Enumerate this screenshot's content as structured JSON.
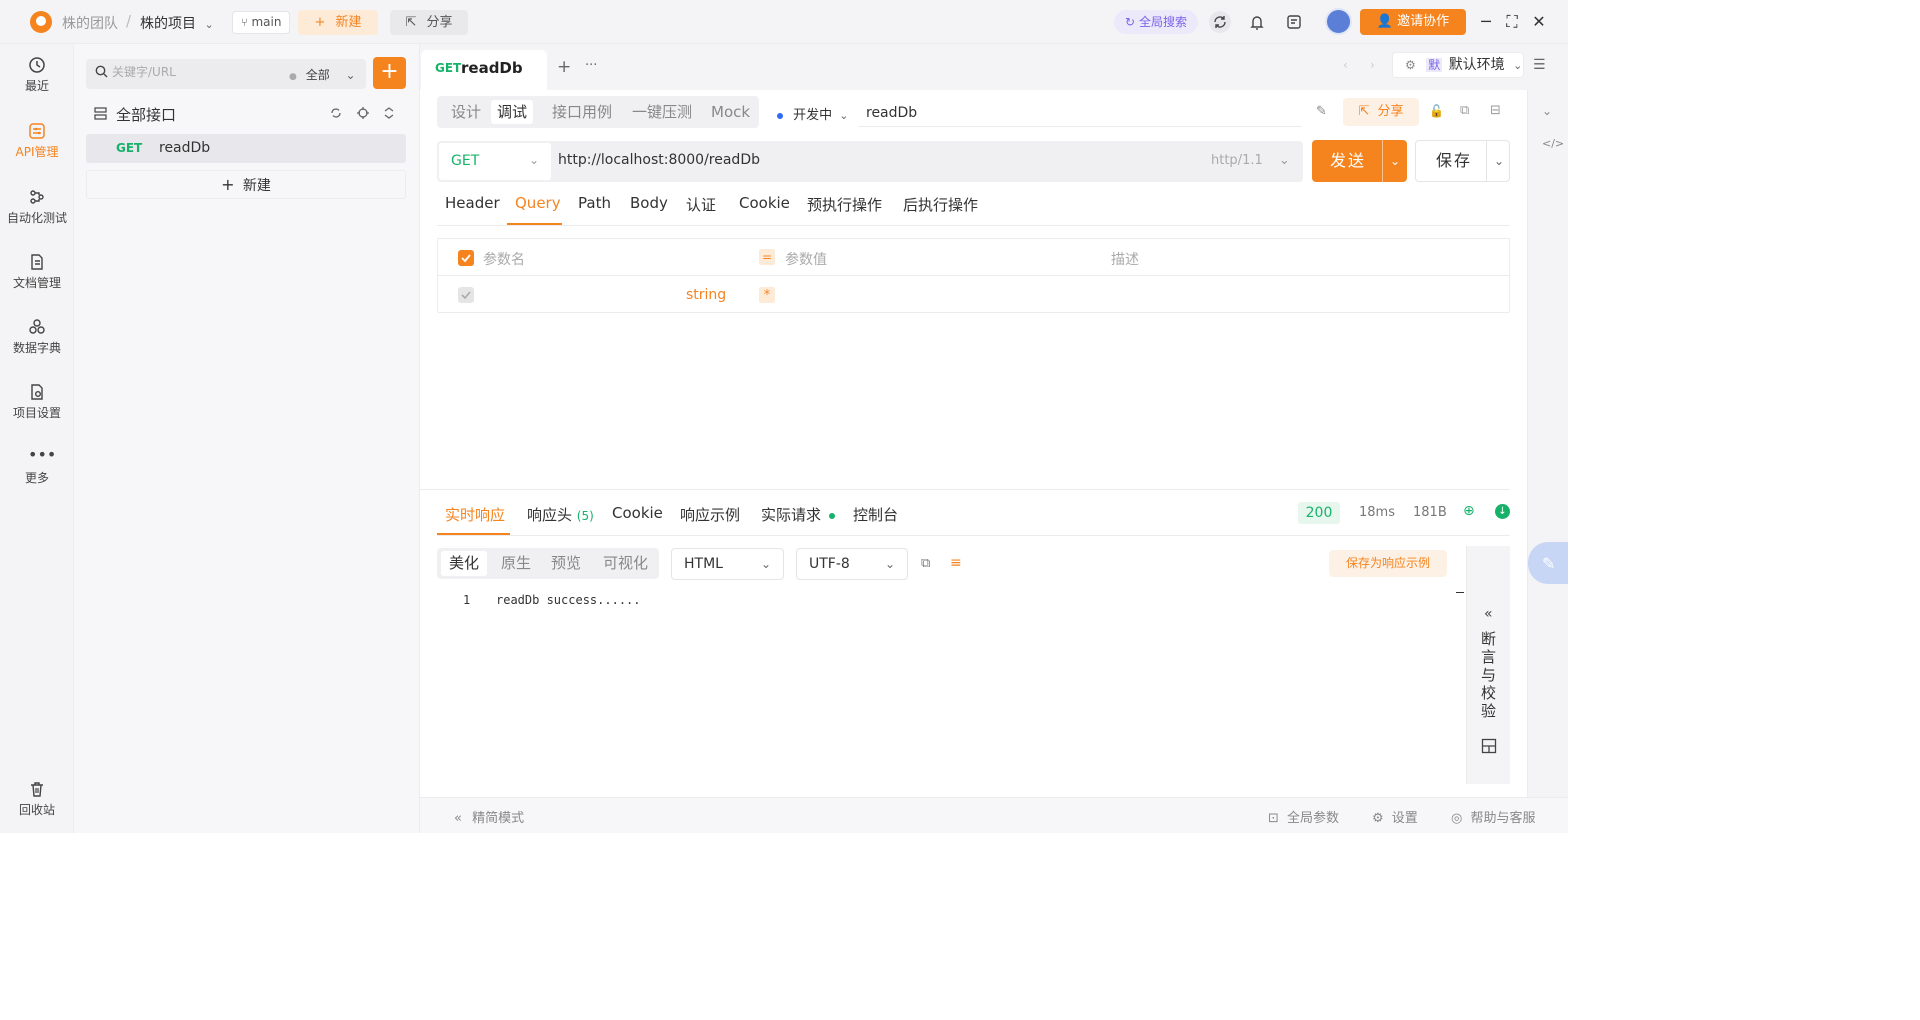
{
  "topbar": {
    "team": "株的团队",
    "separator": "/",
    "project": "株的项目",
    "branch": "main",
    "new_label": "新建",
    "share_label": "分享",
    "global_search": "全局搜索",
    "invite_label": "邀请协作"
  },
  "leftnav": {
    "items": [
      {
        "label": "最近",
        "icon": "history-icon"
      },
      {
        "label": "API管理",
        "icon": "api-icon",
        "active": true
      },
      {
        "label": "自动化测试",
        "icon": "automation-icon"
      },
      {
        "label": "文档管理",
        "icon": "document-icon"
      },
      {
        "label": "数据字典",
        "icon": "data-dictionary-icon"
      },
      {
        "label": "项目设置",
        "icon": "project-settings-icon"
      },
      {
        "label": "更多",
        "icon": "more-icon"
      }
    ],
    "trash_label": "回收站"
  },
  "sidebar": {
    "search_placeholder": "关键字/URL",
    "filter_label": "全部",
    "tree_title": "全部接口",
    "endpoints": [
      {
        "method": "GET",
        "name": "readDb"
      }
    ],
    "new_label": "新建"
  },
  "tabs": {
    "open": [
      {
        "method": "GET",
        "name": "readDb"
      }
    ],
    "environment": "默认环境",
    "env_badge": "默"
  },
  "request": {
    "modes": [
      "设计",
      "调试",
      "接口用例",
      "一键压测",
      "Mock"
    ],
    "active_mode": "调试",
    "status": "开发中",
    "api_name": "readDb",
    "share_label": "分享",
    "method": "GET",
    "url": "http://localhost:8000/readDb",
    "http_version": "http/1.1",
    "send_label": "发送",
    "save_label": "保存",
    "param_tabs": [
      "Header",
      "Query",
      "Path",
      "Body",
      "认证",
      "Cookie",
      "预执行操作",
      "后执行操作"
    ],
    "active_param_tab": "Query",
    "params_header": {
      "name": "参数名",
      "value": "参数值",
      "desc": "描述",
      "eq": "="
    },
    "params_row": {
      "type": "string",
      "required": "*"
    }
  },
  "response": {
    "tabs": [
      "实时响应",
      "响应头",
      "Cookie",
      "响应示例",
      "实际请求",
      "控制台"
    ],
    "header_count": "(5)",
    "status_code": "200",
    "time": "18ms",
    "size": "181B",
    "view_modes": [
      "美化",
      "原生",
      "预览",
      "可视化"
    ],
    "active_view": "美化",
    "format": "HTML",
    "encoding": "UTF-8",
    "save_example": "保存为响应示例",
    "lines": [
      {
        "no": "1",
        "text": "readDb success......"
      }
    ],
    "assert_label": "断言与校验"
  },
  "footer": {
    "compact_mode": "精简模式",
    "global_params": "全局参数",
    "settings": "设置",
    "help": "帮助与客服"
  },
  "colors": {
    "accent": "#f5841f",
    "get_method": "#17b26a",
    "search_purple": "#7c63e8"
  }
}
